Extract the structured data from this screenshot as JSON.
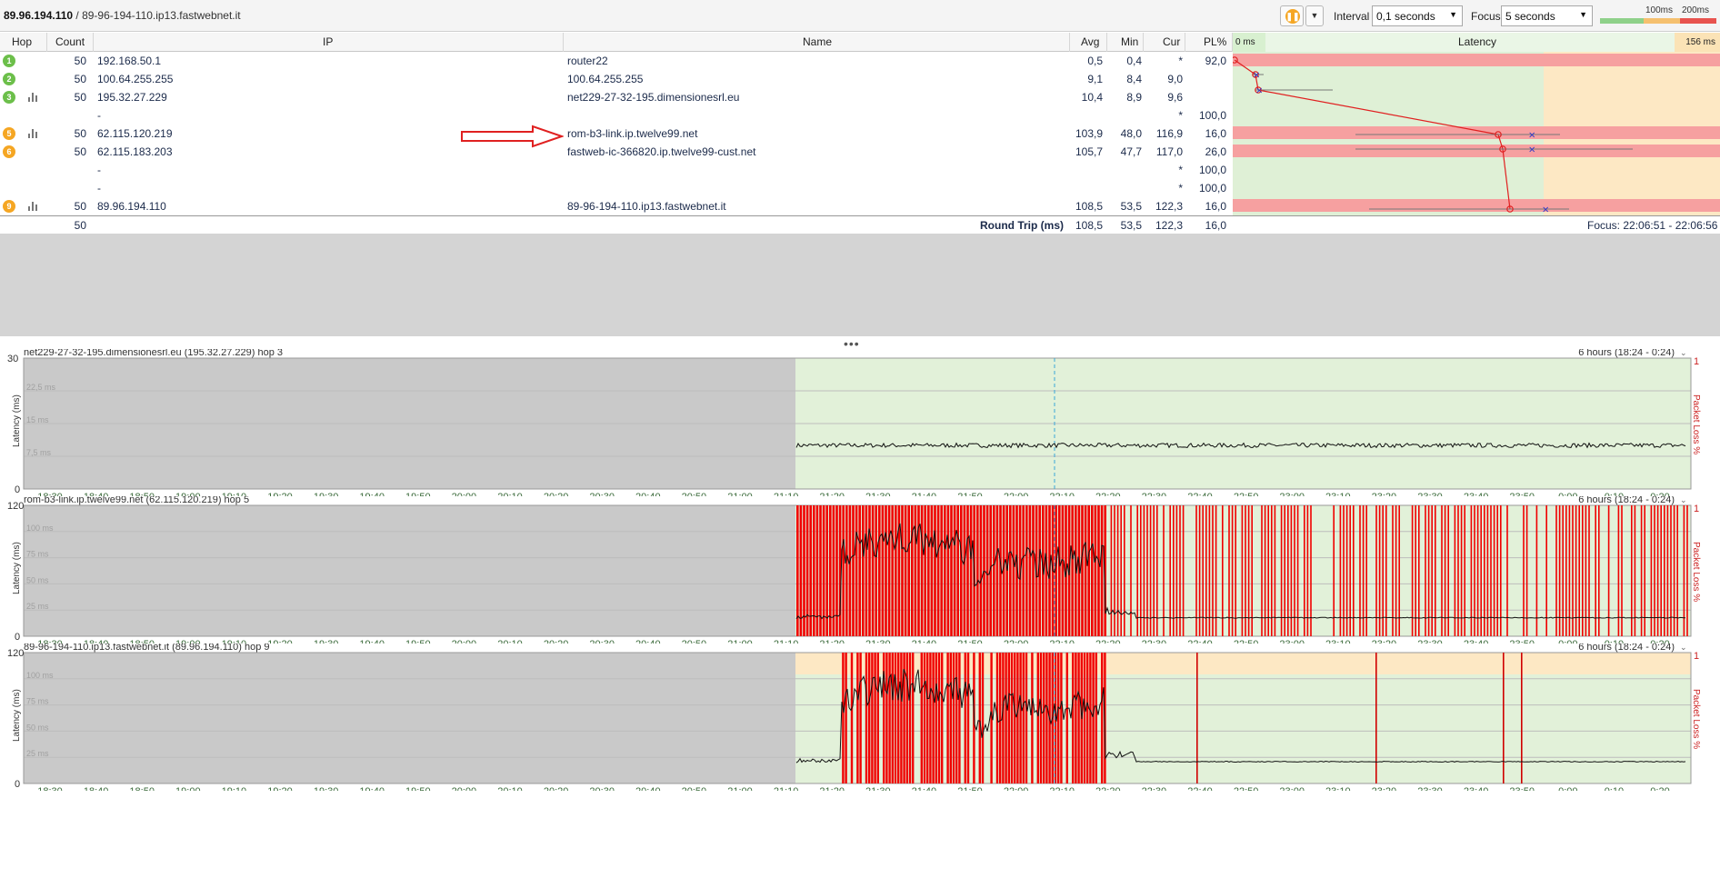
{
  "toolbar": {
    "target_ip": "89.96.194.110",
    "target_host": " / 89-96-194-110.ip13.fastwebnet.it",
    "interval_label": "Interval",
    "interval_value": "0,1 seconds",
    "focus_label": "Focus",
    "focus_value": "5 seconds",
    "legend_100": "100ms",
    "legend_200": "200ms",
    "pause_icon": "pause-icon",
    "colors": {
      "good": "#8fd18a",
      "warn": "#f5c06f",
      "bad": "#e8534f"
    }
  },
  "table": {
    "headers": [
      "Hop",
      "Count",
      "IP",
      "Name",
      "Avg",
      "Min",
      "Cur",
      "PL%",
      "Latency"
    ],
    "latency_min_label": "0 ms",
    "latency_max_label": "156 ms",
    "rows": [
      {
        "hop": "1",
        "count": "50",
        "ip": "192.168.50.1",
        "name": "router22",
        "avg": "0,5",
        "min": "0,4",
        "cur": "*",
        "pl": "92,0",
        "status": "green",
        "bars": false
      },
      {
        "hop": "2",
        "count": "50",
        "ip": "100.64.255.255",
        "name": "100.64.255.255",
        "avg": "9,1",
        "min": "8,4",
        "cur": "9,0",
        "pl": "",
        "status": "green",
        "bars": false
      },
      {
        "hop": "3",
        "count": "50",
        "ip": "195.32.27.229",
        "name": "net229-27-32-195.dimensionesrl.eu",
        "avg": "10,4",
        "min": "8,9",
        "cur": "9,6",
        "pl": "",
        "status": "green",
        "bars": true
      },
      {
        "hop": "",
        "count": "",
        "ip": "-",
        "name": "",
        "avg": "",
        "min": "",
        "cur": "*",
        "pl": "100,0",
        "status": "",
        "bars": false
      },
      {
        "hop": "5",
        "count": "50",
        "ip": "62.115.120.219",
        "name": "rom-b3-link.ip.twelve99.net",
        "avg": "103,9",
        "min": "48,0",
        "cur": "116,9",
        "pl": "16,0",
        "status": "orange",
        "bars": true
      },
      {
        "hop": "6",
        "count": "50",
        "ip": "62.115.183.203",
        "name": "fastweb-ic-366820.ip.twelve99-cust.net",
        "avg": "105,7",
        "min": "47,7",
        "cur": "117,0",
        "pl": "26,0",
        "status": "orange",
        "bars": false
      },
      {
        "hop": "",
        "count": "",
        "ip": "-",
        "name": "",
        "avg": "",
        "min": "",
        "cur": "*",
        "pl": "100,0",
        "status": "",
        "bars": false
      },
      {
        "hop": "",
        "count": "",
        "ip": "-",
        "name": "",
        "avg": "",
        "min": "",
        "cur": "*",
        "pl": "100,0",
        "status": "",
        "bars": false
      },
      {
        "hop": "9",
        "count": "50",
        "ip": "89.96.194.110",
        "name": "89-96-194-110.ip13.fastwebnet.it",
        "avg": "108,5",
        "min": "53,5",
        "cur": "122,3",
        "pl": "16,0",
        "status": "orange",
        "bars": true
      }
    ],
    "footer": {
      "count": "50",
      "label": "Round Trip (ms)",
      "avg": "108,5",
      "min": "53,5",
      "cur": "122,3",
      "pl": "16,0",
      "focus": "Focus: 22:06:51 - 22:06:56"
    }
  },
  "graphs": [
    {
      "title": "net229-27-32-195.dimensionesrl.eu (195.32.27.229) hop 3",
      "range": "6 hours (18:24 - 0:24)",
      "ymax": "30",
      "y_labels": [
        "22,5 ms",
        "15 ms",
        "7,5 ms"
      ],
      "y_zero": "0",
      "pl_max": "1",
      "pl_label": "Packet Loss %",
      "ylabel": "Latency (ms)"
    },
    {
      "title": "rom-b3-link.ip.twelve99.net (62.115.120.219) hop 5",
      "range": "6 hours (18:24 - 0:24)",
      "ymax": "120",
      "y_labels": [
        "100 ms",
        "75 ms",
        "50 ms",
        "25 ms"
      ],
      "y_zero": "0",
      "pl_max": "1",
      "pl_label": "Packet Loss %",
      "ylabel": "Latency (ms)"
    },
    {
      "title": "89-96-194-110.ip13.fastwebnet.it (89.96.194.110) hop 9",
      "range": "6 hours (18:24 - 0:24)",
      "ymax": "120",
      "y_labels": [
        "100 ms",
        "75 ms",
        "50 ms",
        "25 ms"
      ],
      "y_zero": "0",
      "pl_max": "1",
      "pl_label": "Packet Loss %",
      "ylabel": "Latency (ms)"
    }
  ],
  "time_ticks": [
    "18:30",
    "18:40",
    "18:50",
    "19:00",
    "19:10",
    "19:20",
    "19:30",
    "19:40",
    "19:50",
    "20:00",
    "20:10",
    "20:20",
    "20:30",
    "20:40",
    "20:50",
    "21:00",
    "21:10",
    "21:20",
    "21:30",
    "21:40",
    "21:50",
    "22:00",
    "22:10",
    "22:20",
    "22:30",
    "22:40",
    "22:50",
    "23:00",
    "23:10",
    "23:20",
    "23:30",
    "23:40",
    "23:50",
    "0:00",
    "0:10",
    "0:20"
  ]
}
